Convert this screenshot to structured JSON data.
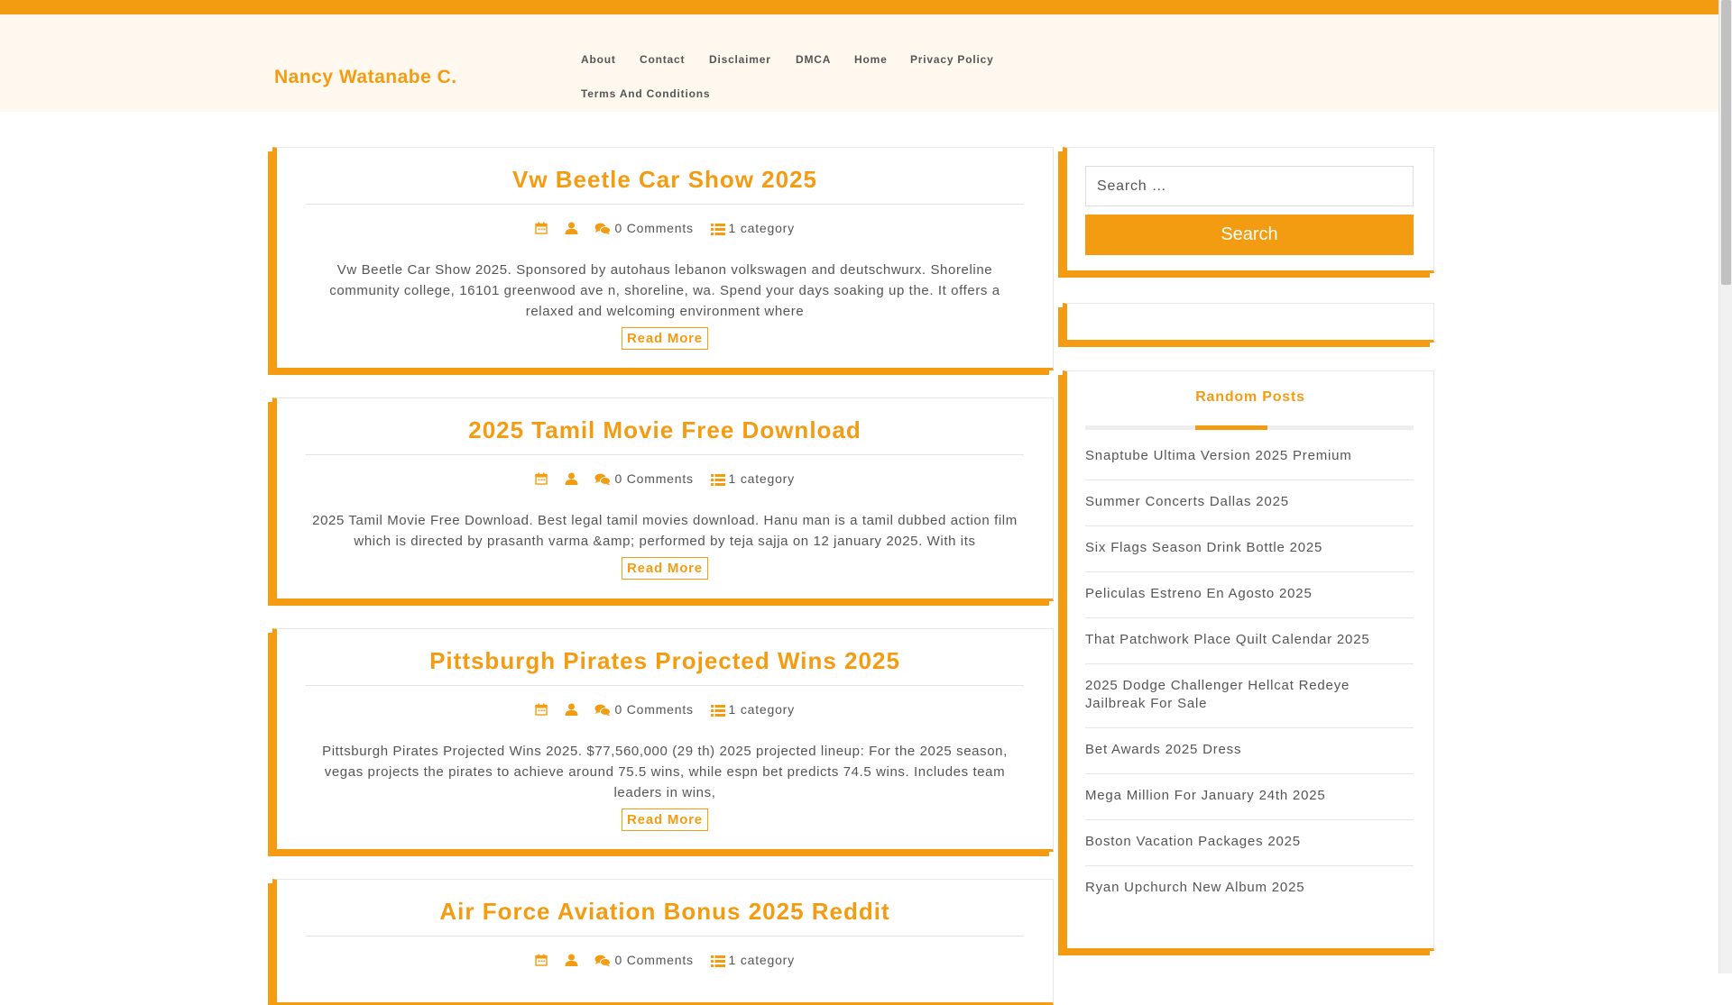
{
  "header": {
    "site_title": "Nancy Watanabe C.",
    "nav": [
      "About",
      "Contact",
      "Disclaimer",
      "DMCA",
      "Home",
      "Privacy Policy",
      "Terms And Conditions"
    ]
  },
  "posts": [
    {
      "title": "Vw Beetle Car Show 2025",
      "comments": "0 Comments",
      "category": "1 category",
      "excerpt": "Vw Beetle Car Show 2025. Sponsored by autohaus lebanon volkswagen and deutschwurx. Shoreline community college, 16101 greenwood ave n, shoreline, wa. Spend your days soaking up the. It offers a relaxed and welcoming environment where",
      "read_more": "Read More"
    },
    {
      "title": "2025 Tamil Movie Free Download",
      "comments": "0 Comments",
      "category": "1 category",
      "excerpt": "2025 Tamil Movie Free Download. Best legal tamil movies download. Hanu man is a tamil dubbed action film which is directed by prasanth varma &amp; performed by teja sajja on 12 january 2025. With its",
      "read_more": "Read More"
    },
    {
      "title": "Pittsburgh Pirates Projected Wins 2025",
      "comments": "0 Comments",
      "category": "1 category",
      "excerpt": "Pittsburgh Pirates Projected Wins 2025. $77,560,000 (29 th) 2025 projected lineup: For the 2025 season, vegas projects the pirates to achieve around 75.5 wins, while espn bet predicts 74.5 wins. Includes team leaders in wins,",
      "read_more": "Read More"
    },
    {
      "title": "Air Force Aviation Bonus 2025 Reddit",
      "comments": "0 Comments",
      "category": "1 category"
    }
  ],
  "sidebar": {
    "search": {
      "placeholder": "Search …",
      "button_label": "Search"
    },
    "random_posts": {
      "title": "Random Posts",
      "items": [
        "Snaptube Ultima Version 2025 Premium",
        "Summer Concerts Dallas 2025",
        "Six Flags Season Drink Bottle 2025",
        "Peliculas Estreno En Agosto 2025",
        "That Patchwork Place Quilt Calendar 2025",
        "2025 Dodge Challenger Hellcat Redeye Jailbreak For Sale",
        "Bet Awards 2025 Dress",
        "Mega Million For January 24th 2025",
        "Boston Vacation Packages 2025",
        "Ryan Upchurch New Album 2025"
      ]
    }
  },
  "colors": {
    "accent": "#f39c12",
    "header_bg": "#fff8ee",
    "text": "#555555"
  },
  "icons": {
    "date": "calendar-icon",
    "author": "user-icon",
    "comments": "comments-icon",
    "category": "list-icon"
  }
}
